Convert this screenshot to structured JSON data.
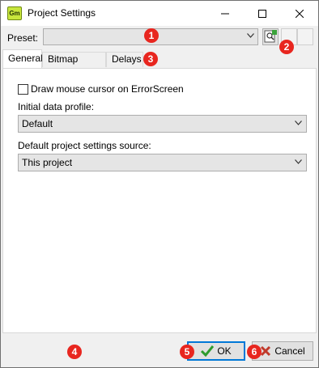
{
  "window": {
    "title": "Project Settings",
    "app_icon_text": "Gm"
  },
  "preset": {
    "label": "Preset:",
    "value": ""
  },
  "tabs": [
    {
      "label": "General",
      "active": true
    },
    {
      "label": "Bitmap Search",
      "active": false
    },
    {
      "label": "Delays",
      "active": false
    }
  ],
  "general": {
    "checkbox_label": "Draw mouse cursor on ErrorScreen",
    "checkbox_checked": false,
    "data_profile_label": "Initial data profile:",
    "data_profile_value": "Default",
    "settings_source_label": "Default project settings source:",
    "settings_source_value": "This project"
  },
  "buttons": {
    "ok": "OK",
    "cancel": "Cancel"
  },
  "callouts": [
    "1",
    "2",
    "3",
    "4",
    "5",
    "6"
  ],
  "colors": {
    "callout": "#e8261f",
    "ok_icon": "#2e9c2e",
    "cancel_icon": "#c0392b",
    "focus": "#0078d7"
  }
}
